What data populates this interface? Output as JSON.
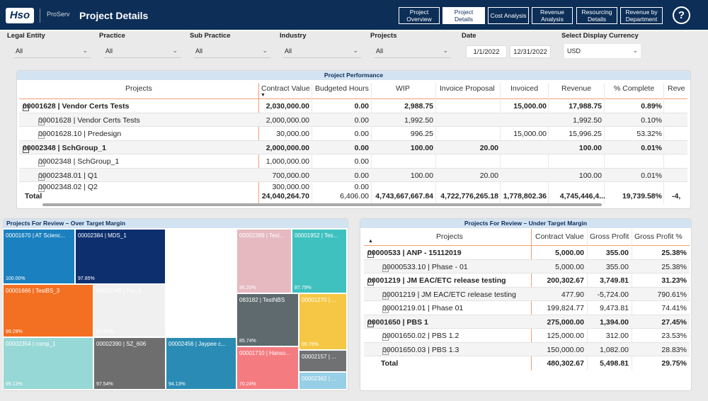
{
  "header": {
    "logo": "Hso",
    "brand": "ProServ",
    "title": "Project Details",
    "nav": [
      "Project Overview",
      "Project Details",
      "Cost Analysis",
      "Revenue Analysis",
      "Resourcing Details",
      "Revenue by Department"
    ],
    "active_nav": "Project Details",
    "help": "?"
  },
  "filters": {
    "legal_entity": {
      "label": "Legal Entity",
      "value": "All"
    },
    "practice": {
      "label": "Practice",
      "value": "All"
    },
    "sub_practice": {
      "label": "Sub Practice",
      "value": "All"
    },
    "industry": {
      "label": "Industry",
      "value": "All"
    },
    "projects": {
      "label": "Projects",
      "value": "All"
    },
    "date": {
      "label": "Date",
      "from": "1/1/2022",
      "to": "12/31/2022"
    },
    "currency": {
      "label": "Select Display Currency",
      "value": "USD"
    }
  },
  "performance": {
    "title": "Project Performance",
    "headers": [
      "Projects",
      "Contract Value",
      "Budgeted Hours",
      "WIP",
      "Invoice Proposal",
      "Invoiced",
      "Revenue",
      "% Complete",
      "Reve"
    ],
    "rows": [
      {
        "level": 0,
        "bold": true,
        "project": "00001628 | Vendor Certs Tests",
        "cv": "2,030,000.00",
        "bh": "0.00",
        "wip": "2,988.75",
        "ip": "",
        "inv": "15,000.00",
        "rev": "17,988.75",
        "pc": "0.89%"
      },
      {
        "level": 1,
        "bold": false,
        "project": "00001628 | Vendor Certs Tests",
        "cv": "2,000,000.00",
        "bh": "0.00",
        "wip": "1,992.50",
        "ip": "",
        "inv": "",
        "rev": "1,992.50",
        "pc": "0.10%"
      },
      {
        "level": 1,
        "bold": false,
        "project": "00001628.10 | Predesign",
        "cv": "30,000.00",
        "bh": "0.00",
        "wip": "996.25",
        "ip": "",
        "inv": "15,000.00",
        "rev": "15,996.25",
        "pc": "53.32%"
      },
      {
        "level": 0,
        "bold": true,
        "project": "00002348 | SchGroup_1",
        "cv": "2,000,000.00",
        "bh": "0.00",
        "wip": "100.00",
        "ip": "20.00",
        "inv": "",
        "rev": "100.00",
        "pc": "0.01%"
      },
      {
        "level": 1,
        "bold": false,
        "project": "00002348 | SchGroup_1",
        "cv": "1,000,000.00",
        "bh": "0.00",
        "wip": "",
        "ip": "",
        "inv": "",
        "rev": "",
        "pc": ""
      },
      {
        "level": 1,
        "bold": false,
        "project": "00002348.01 | Q1",
        "cv": "700,000.00",
        "bh": "0.00",
        "wip": "100.00",
        "ip": "20.00",
        "inv": "",
        "rev": "100.00",
        "pc": "0.01%"
      },
      {
        "level": 1,
        "bold": false,
        "project": "00002348.02 | Q2",
        "cv": "300,000.00",
        "bh": "0.00",
        "wip": "",
        "ip": "",
        "inv": "",
        "rev": "",
        "pc": ""
      }
    ],
    "total": {
      "label": "Total",
      "cv": "24,040,264.70",
      "bh": "6,406.00",
      "wip": "4,743,667,667.84",
      "ip": "4,722,776,265.18",
      "inv": "1,778,802.36",
      "rev": "4,745,446,4...",
      "pc": "19,739.58%",
      "extra": "-4,"
    }
  },
  "over_target": {
    "title": "Projects For Review – Over Target Margin",
    "tiles": [
      {
        "label": "00001670 | AT Scienc...",
        "pct": "100.00%",
        "color": "#1a80bf"
      },
      {
        "label": "00002384 | MDS_1",
        "pct": "97.85%",
        "color": "#0d2f6e"
      },
      {
        "label": "00001666 | TestBS_3",
        "pct": "99.29%",
        "color": "#f36f21"
      },
      {
        "label": "00002348 | Pro_1",
        "pct": "97.82%",
        "color": "#f0f0f0"
      },
      {
        "label": "00002389 | Test...",
        "pct": "90.20%",
        "color": "#e6b9c1"
      },
      {
        "label": "00001952 | Tes...",
        "pct": "87.79%",
        "color": "#3fc1c0"
      },
      {
        "label": "083182 | TestNBS",
        "pct": "85.74%",
        "color": "#5e6a6d"
      },
      {
        "label": "00001270 | ...",
        "pct": "69.76%",
        "color": "#f6c744"
      },
      {
        "label": "00001710 | Hanso...",
        "pct": "70.24%",
        "color": "#f47b80"
      },
      {
        "label": "00002157 | ...",
        "pct": "",
        "color": "#6f7172"
      },
      {
        "label": "00002362 | ...",
        "pct": "",
        "color": "#97cfe6"
      },
      {
        "label": "00002354 | comp_1",
        "pct": "99.13%",
        "color": "#96d8d5"
      },
      {
        "label": "00002390 | SZ_606",
        "pct": "97.54%",
        "color": "#6e6e6e"
      },
      {
        "label": "00002456 | Jaypee c...",
        "pct": "94.13%",
        "color": "#2a8cb4"
      }
    ]
  },
  "under_target": {
    "title": "Projects For Review – Under Target Margin",
    "headers": [
      "Projects",
      "Contract Value",
      "Gross Profit",
      "Gross Profit %"
    ],
    "rows": [
      {
        "level": 0,
        "bold": true,
        "project": "00000533 | ANP - 15112019",
        "cv": "5,000.00",
        "gp": "355.00",
        "gpp": "25.38%"
      },
      {
        "level": 1,
        "bold": false,
        "project": "00000533.10 | Phase - 01",
        "cv": "5,000.00",
        "gp": "355.00",
        "gpp": "25.38%"
      },
      {
        "level": 0,
        "bold": true,
        "project": "00001219 | JM EAC/ETC release testing",
        "cv": "200,302.67",
        "gp": "3,749.81",
        "gpp": "31.23%"
      },
      {
        "level": 1,
        "bold": false,
        "project": "00001219 | JM EAC/ETC release testing",
        "cv": "477.90",
        "gp": "-5,724.00",
        "gpp": "790.61%"
      },
      {
        "level": 1,
        "bold": false,
        "project": "00001219.01 | Phase 01",
        "cv": "199,824.77",
        "gp": "9,473.81",
        "gpp": "74.41%"
      },
      {
        "level": 0,
        "bold": true,
        "project": "00001650 | PBS 1",
        "cv": "275,000.00",
        "gp": "1,394.00",
        "gpp": "27.45%"
      },
      {
        "level": 1,
        "bold": false,
        "project": "00001650.02 | PBS 1.2",
        "cv": "125,000.00",
        "gp": "312.00",
        "gpp": "23.53%"
      },
      {
        "level": 1,
        "bold": false,
        "project": "00001650.03 | PBS 1.3",
        "cv": "150,000.00",
        "gp": "1,082.00",
        "gpp": "28.83%"
      }
    ],
    "total": {
      "label": "Total",
      "cv": "480,302.67",
      "gp": "5,498.81",
      "gpp": "29.75%"
    }
  }
}
